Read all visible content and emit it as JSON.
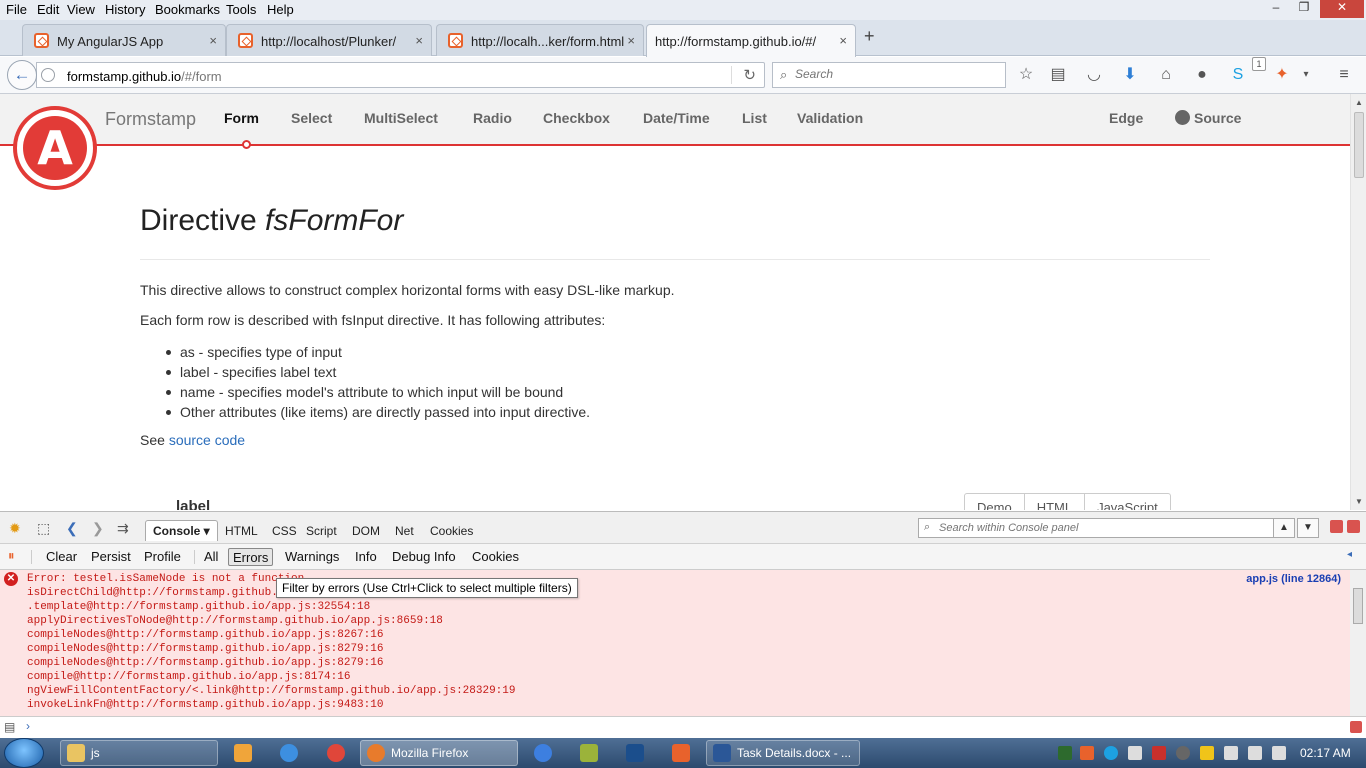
{
  "menubar": {
    "items": [
      "File",
      "Edit",
      "View",
      "History",
      "Bookmarks",
      "Tools",
      "Help"
    ]
  },
  "window_controls": {
    "minimize": "–",
    "maximize": "❐",
    "close": "✕"
  },
  "tabs": [
    {
      "title": "My AngularJS App",
      "active": false
    },
    {
      "title": "http://localhost/Plunker/",
      "active": false
    },
    {
      "title": "http://localh...ker/form.html",
      "active": false
    },
    {
      "title": "http://formstamp.github.io/#/",
      "active": true
    }
  ],
  "tab_close": "×",
  "new_tab": "+",
  "navbar": {
    "back": "←",
    "url_host": "formstamp.github.io",
    "url_path": "/#/form",
    "reload": "↻",
    "search_placeholder": "Search",
    "search_glyph": "⌕",
    "toolbar_icons": [
      "star-icon",
      "reading-list-icon",
      "pocket-icon",
      "download-icon",
      "home-icon",
      "chat-icon",
      "skype-icon",
      "addon-icon",
      "dropdown-icon",
      "hamburger-menu-icon"
    ],
    "badge": "1"
  },
  "site": {
    "brand": "Formstamp",
    "nav": [
      "Form",
      "Select",
      "MultiSelect",
      "Radio",
      "Checkbox",
      "Date/Time",
      "List",
      "Validation"
    ],
    "active_nav": "Form",
    "right_nav": [
      "Edge",
      "Source"
    ],
    "logo_letter": "A",
    "accent_color": "#dd3333"
  },
  "content": {
    "title_prefix": "Directive ",
    "title_em": "fsFormFor",
    "intro": "This directive allows to construct complex horizontal forms with easy DSL-like markup.",
    "row_desc": "Each form row is described with fsInput directive. It has following attributes:",
    "bullets": [
      "as - specifies type of input",
      "label - specifies label text",
      "name - specifies model's attribute to which input will be bound",
      "Other attributes (like items) are directly passed into input directive."
    ],
    "see_prefix": "See ",
    "see_link": "source code",
    "cut_label": "label",
    "cut_tabs": [
      "Demo",
      "HTML",
      "JavaScript"
    ]
  },
  "firebug": {
    "tabs": [
      "Console",
      "HTML",
      "CSS",
      "Script",
      "DOM",
      "Net",
      "Cookies"
    ],
    "active_tab": "Console",
    "search_placeholder": "Search within Console panel",
    "filters": [
      "Clear",
      "Persist",
      "Profile",
      "All",
      "Errors",
      "Warnings",
      "Info",
      "Debug Info",
      "Cookies"
    ],
    "active_filter": "Errors",
    "tooltip": "Filter by errors (Use Ctrl+Click to select multiple filters)",
    "log_source": "app.js (line 12864)",
    "log_lines": [
      "Error: testel.isSameNode is not a function",
      "isDirectChild@http://formstamp.github.io/app.js",
      ".template@http://formstamp.github.io/app.js:32554:18",
      "applyDirectivesToNode@http://formstamp.github.io/app.js:8659:18",
      "compileNodes@http://formstamp.github.io/app.js:8267:16",
      "compileNodes@http://formstamp.github.io/app.js:8279:16",
      "compileNodes@http://formstamp.github.io/app.js:8279:16",
      "compile@http://formstamp.github.io/app.js:8174:16",
      "ngViewFillContentFactory/<.link@http://formstamp.github.io/app.js:28329:19",
      "invokeLinkFn@http://formstamp.github.io/app.js:9483:10"
    ],
    "error_color": "#c41a16",
    "log_bg": "#fde4e4"
  },
  "taskbar": {
    "buttons": [
      "js",
      "Mozilla Firefox",
      "Task Details.docx - ..."
    ],
    "clock": "02:17 AM",
    "app_icons": [
      "media-player-icon",
      "ie-icon",
      "chrome-icon",
      "chromium-icon",
      "dreamweaver-icon",
      "photoshop-icon",
      "xampp-icon"
    ]
  }
}
